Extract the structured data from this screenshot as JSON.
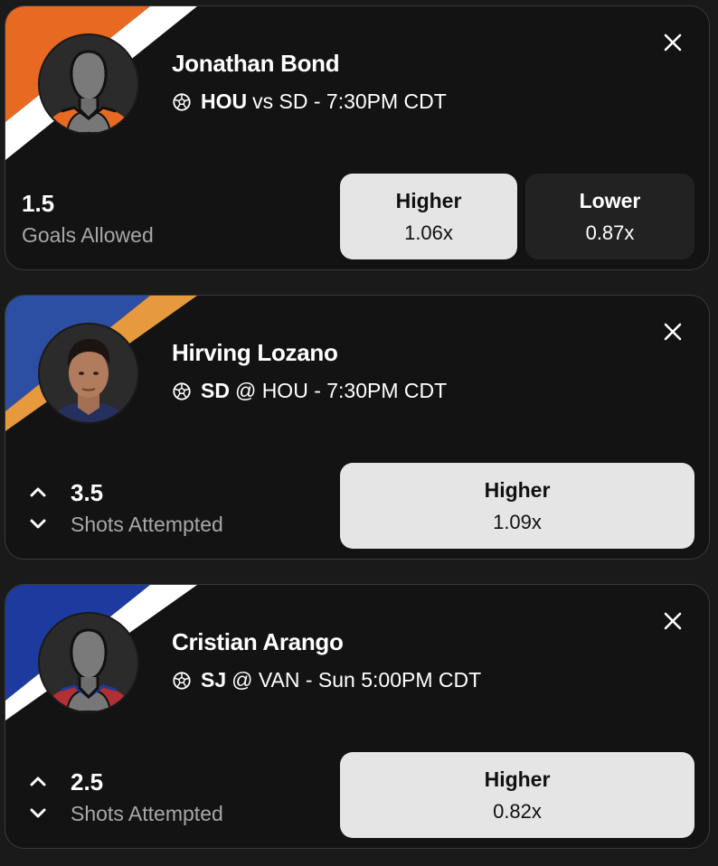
{
  "cards": [
    {
      "player": "Jonathan Bond",
      "matchup_team": "HOU",
      "matchup_rest": "vs SD - 7:30PM CDT",
      "line": "1.5",
      "stat": "Goals Allowed",
      "options": [
        {
          "label": "Higher",
          "multiplier": "1.06x",
          "selected": true
        },
        {
          "label": "Lower",
          "multiplier": "0.87x",
          "selected": false
        }
      ],
      "team_colors": {
        "primary": "#e86a22",
        "stripe": "#ffffff"
      },
      "avatar": "default-player-silhouette",
      "jersey_color": "#e86a22"
    },
    {
      "player": "Hirving Lozano",
      "matchup_team": "SD",
      "matchup_rest": "@ HOU - 7:30PM CDT",
      "line": "3.5",
      "stat": "Shots Attempted",
      "options": [
        {
          "label": "Higher",
          "multiplier": "1.09x",
          "selected": true
        }
      ],
      "team_colors": {
        "primary": "#2d4fa3",
        "stripe": "#e6993d"
      },
      "avatar": "player-photo"
    },
    {
      "player": "Cristian Arango",
      "matchup_team": "SJ",
      "matchup_rest": "@ VAN - Sun 5:00PM CDT",
      "line": "2.5",
      "stat": "Shots Attempted",
      "options": [
        {
          "label": "Higher",
          "multiplier": "0.82x",
          "selected": true
        }
      ],
      "team_colors": {
        "primary": "#1d3a9e",
        "stripe": "#ffffff"
      },
      "avatar": "default-player-silhouette",
      "jersey_color": "#b03036"
    }
  ],
  "icons": {
    "close": "close-icon",
    "sport": "soccer-ball-icon",
    "up": "chevron-up-icon",
    "down": "chevron-down-icon"
  },
  "colors": {
    "card_bg": "#131313",
    "selected_button": "#e5e5e5",
    "unselected_button": "#222222",
    "secondary_text": "#a8a8a8"
  }
}
